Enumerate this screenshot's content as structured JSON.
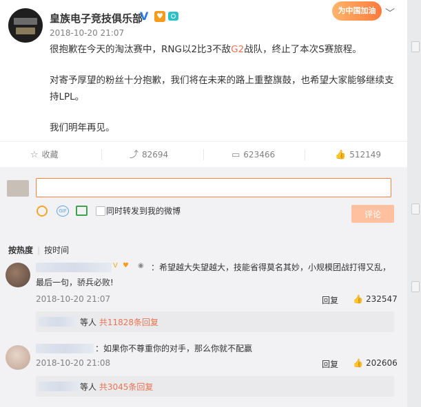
{
  "post": {
    "username": "皇族电子竞技俱乐部",
    "timestamp": "2018-10-20 21:07",
    "badge_text": "为中国加油",
    "paragraph1_before": "很抱歉在今天的淘汰赛中，RNG以2比3不敌",
    "paragraph1_highlight": "G2",
    "paragraph1_after": "战队，终止了本次S赛旅程。",
    "paragraph2": "对寄予厚望的粉丝十分抱歉，我们将在未来的路上重整旗鼓，也希望大家能够继续支持LPL。",
    "paragraph3": "我们明年再见。"
  },
  "actions": {
    "favorite_label": "收藏",
    "repost_count": "82694",
    "comment_count": "623466",
    "like_count": "512149"
  },
  "composer": {
    "placeholder": "",
    "forward_label": "同时转发到我的微博",
    "submit_label": "评论"
  },
  "sort": {
    "hot_label": "按热度",
    "time_label": "按时间"
  },
  "comments": [
    {
      "text": "：希望越大失望越大，技能省得莫名其妙，小规模团战打得又乱，最后一句，骄兵必败!",
      "time": "2018-10-20 21:07",
      "reply_label": "回复",
      "likes": "232547",
      "sub_prefix": "等人 ",
      "sub_link": "共11828条回复"
    },
    {
      "text": "：如果你不尊重你的对手，那么你就不配赢",
      "time": "2018-10-20 21:08",
      "reply_label": "回复",
      "likes": "202606",
      "sub_prefix": "等人 ",
      "sub_link": "共3045条回复"
    }
  ],
  "icons": {
    "verified": "verified-v-icon",
    "fan": "fan-badge-icon",
    "camera": "camera-icon",
    "favorite": "star-icon",
    "repost": "repost-icon",
    "comment": "comment-icon",
    "like": "thumbs-up-icon",
    "emoji": "emoji-icon",
    "gif": "gif-icon",
    "image": "image-icon"
  },
  "colors": {
    "accent": "#eb7350",
    "input_border": "#ff8140",
    "submit_bg": "#ffc09f",
    "verified": "#2a7ae2"
  }
}
